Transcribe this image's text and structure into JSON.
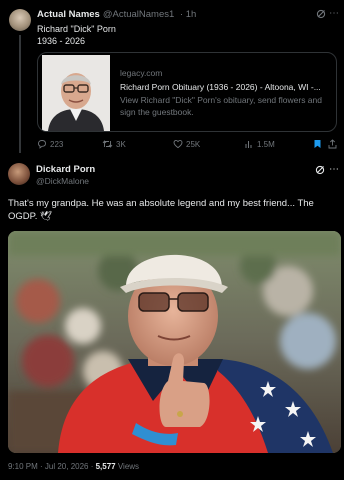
{
  "quoted_tweet": {
    "author_name": "Actual Names",
    "author_handle": "@ActualNames1",
    "time": "· 1h",
    "text_line1": "Richard \"Dick\" Porn",
    "text_line2": "1936 - 2026",
    "card": {
      "domain": "legacy.com",
      "title": "Richard Porn Obituary (1936 - 2026) - Altoona, WI -...",
      "description": "View Richard \"Dick\" Porn's obituary, send flowers and sign the guestbook."
    },
    "actions": {
      "replies": "223",
      "retweets": "3K",
      "likes": "25K",
      "views": "1.5M"
    }
  },
  "main_tweet": {
    "author_name": "Dickard Porn",
    "author_handle": "@DickMalone",
    "text": "That's my grandpa. He was an absolute legend and my best friend... The OGDP. 🕊",
    "timestamp": "9:10 PM · Jul 20, 2026 · ",
    "views_count": "5,577",
    "views_label": " Views"
  },
  "icons": {
    "reply": "reply-icon",
    "retweet": "retweet-icon",
    "like": "heart-icon",
    "views": "views-icon",
    "bookmark": "bookmark-icon",
    "share": "share-icon",
    "grok": "grok-icon",
    "more": "more-icon"
  },
  "colors": {
    "background": "#000000",
    "text": "#e7e9ea",
    "muted": "#71767b",
    "accent": "#1d9bf0"
  }
}
